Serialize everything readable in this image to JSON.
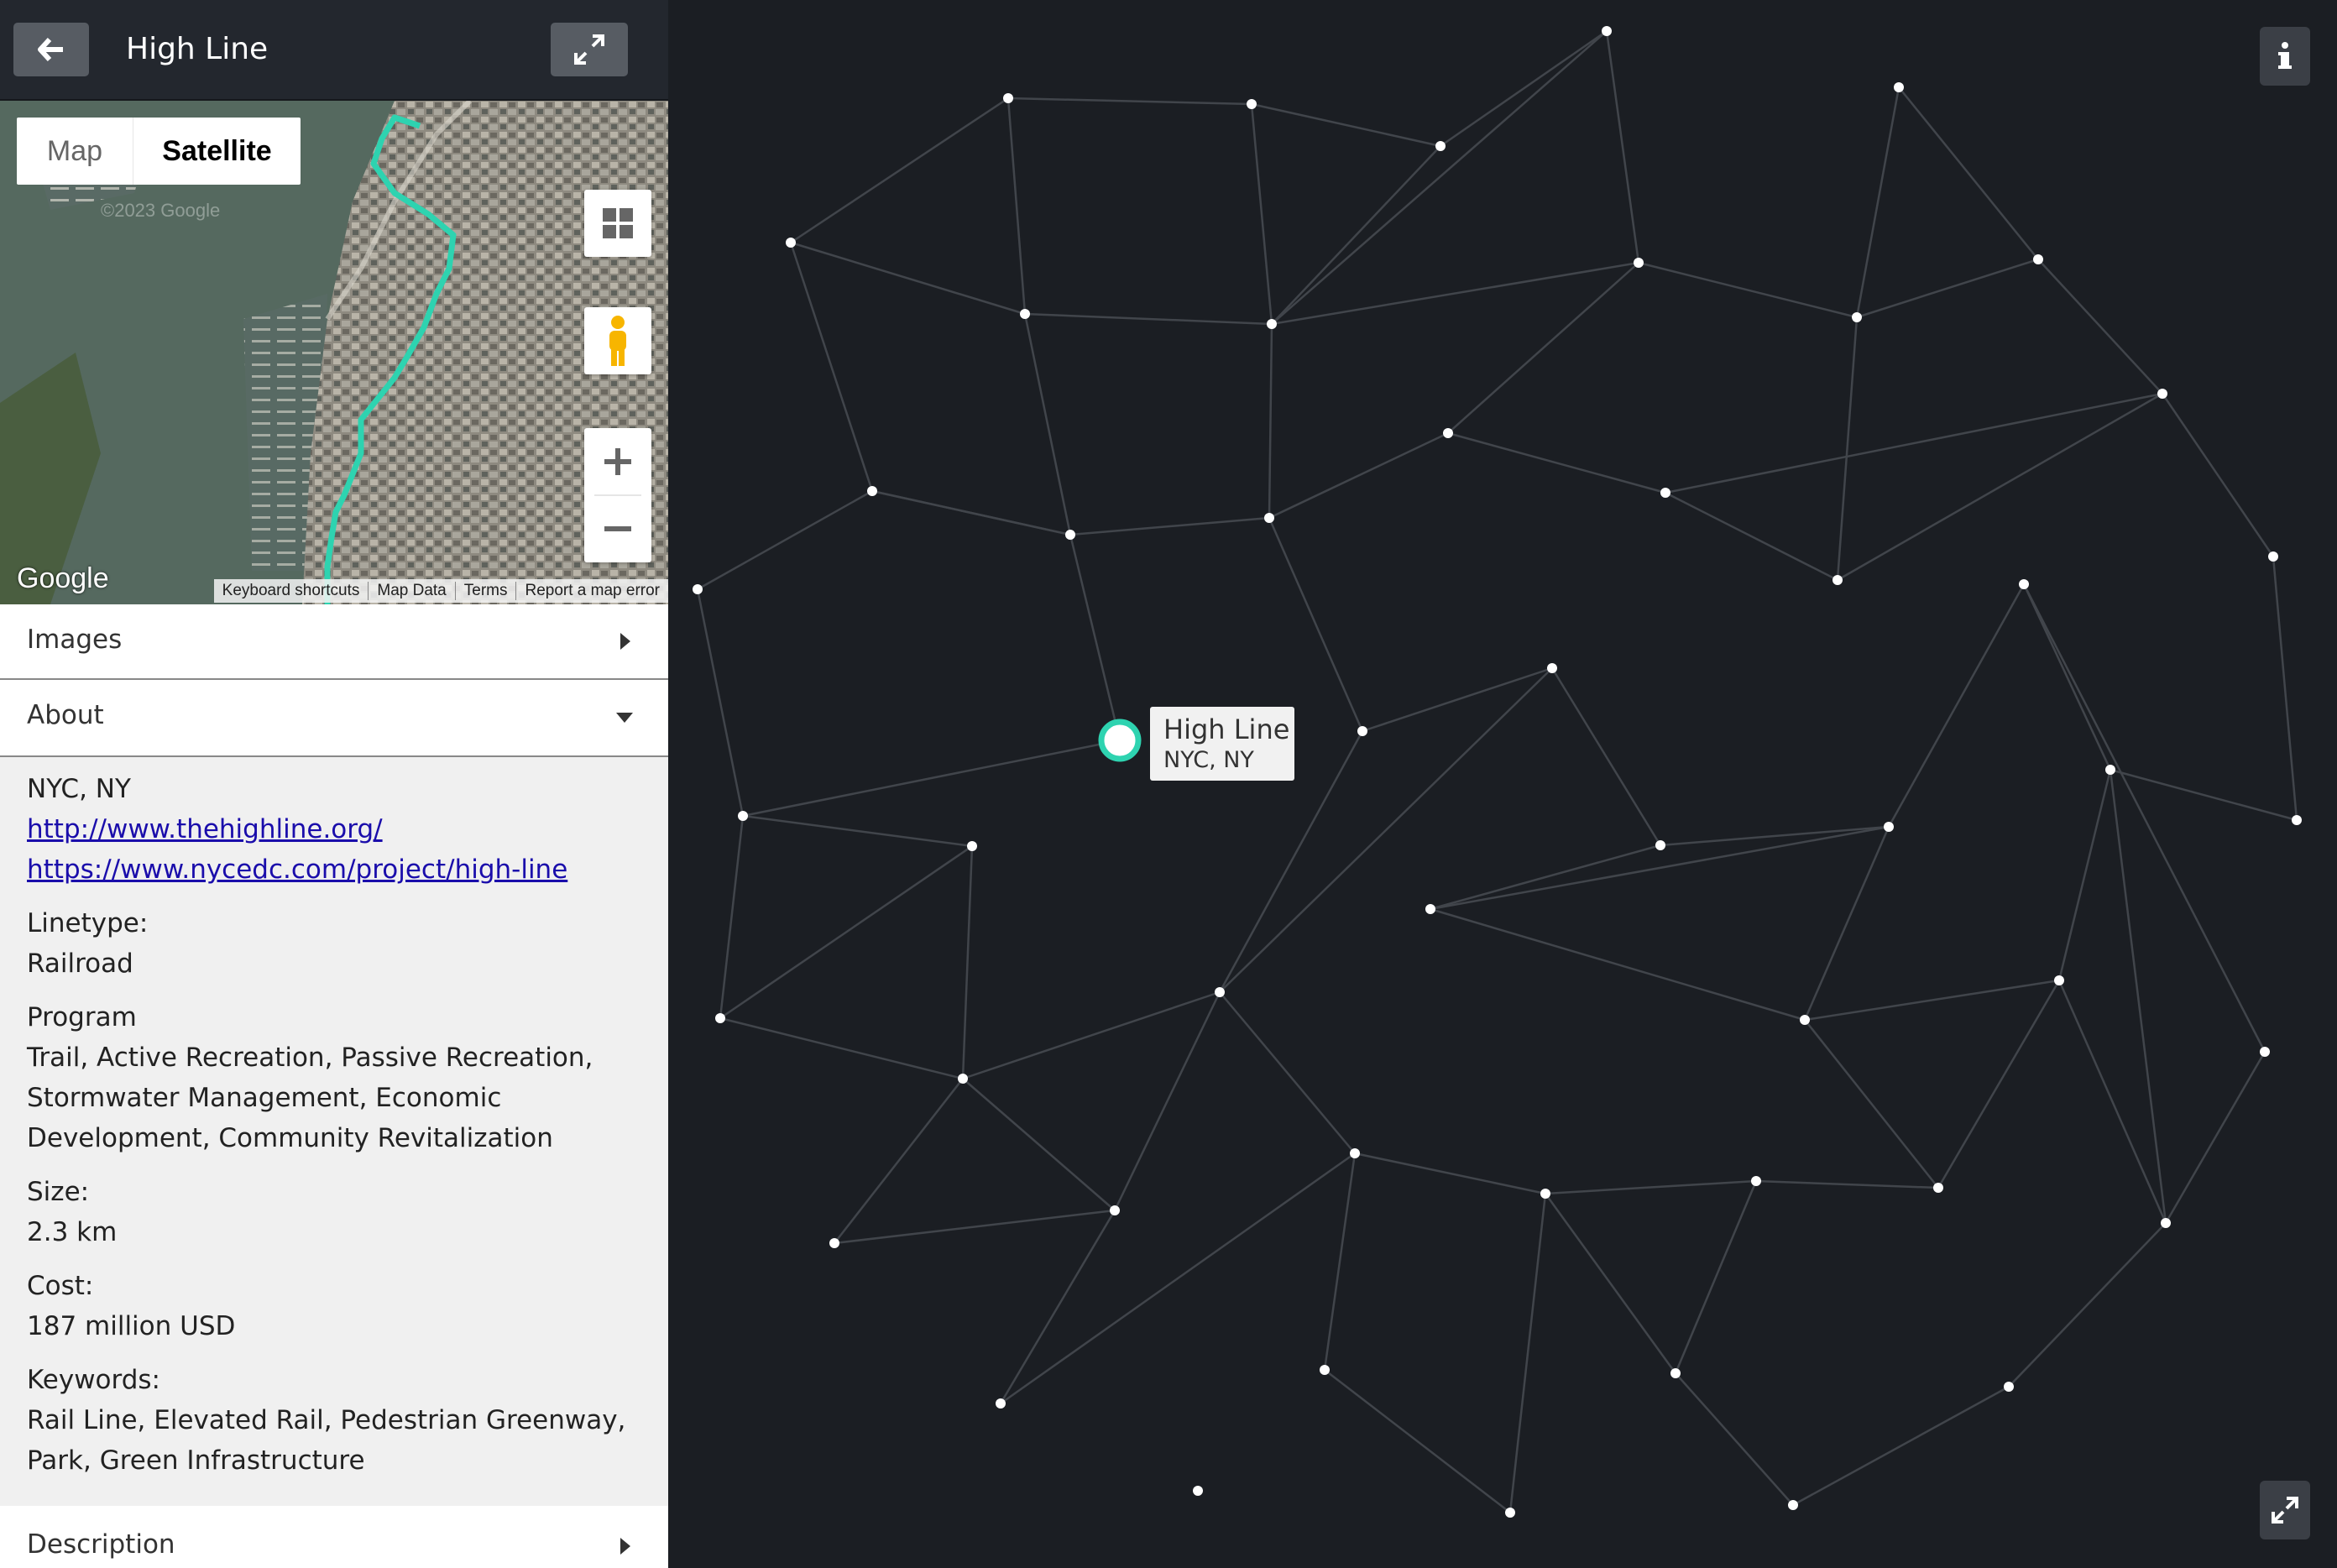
{
  "header": {
    "title": "High Line",
    "back_icon": "arrow-left-icon",
    "expand_icon": "expand-icon"
  },
  "map": {
    "type_map_label": "Map",
    "type_satellite_label": "Satellite",
    "selected_type": "Satellite",
    "watermark": "©2023 Google",
    "logo": "Google",
    "footer": [
      "Keyboard shortcuts",
      "Map Data",
      "Terms",
      "Report a map error"
    ],
    "route_color": "#2ed3b0"
  },
  "sections": {
    "images": {
      "label": "Images",
      "state": "collapsed"
    },
    "about": {
      "label": "About",
      "state": "expanded"
    },
    "description": {
      "label": "Description",
      "state": "collapsed"
    }
  },
  "about": {
    "location": "NYC, NY",
    "links": [
      "http://www.thehighline.org/",
      "https://www.nycedc.com/project/high-line"
    ],
    "linetype_label": "Linetype:",
    "linetype_value": "Railroad",
    "program_label": "Program",
    "program_lines": [
      "Trail, Active Recreation, Passive Recreation,",
      "Stormwater Management, Economic",
      "Development, Community Revitalization"
    ],
    "size_label": "Size:",
    "size_value": "2.3 km",
    "cost_label": "Cost:",
    "cost_value": "187 million USD",
    "keywords_label": "Keywords:",
    "keywords_lines": [
      "Rail Line, Elevated Rail, Pedestrian Greenway,",
      "Park, Green Infrastructure"
    ]
  },
  "graph": {
    "selected_node": {
      "title": "High Line",
      "subtitle": "NYC, NY"
    },
    "accent": "#2ed3b0",
    "background": "#1b1e23"
  },
  "controls": {
    "info_icon": "info-icon",
    "fullscreen_icon": "fullscreen-icon"
  }
}
